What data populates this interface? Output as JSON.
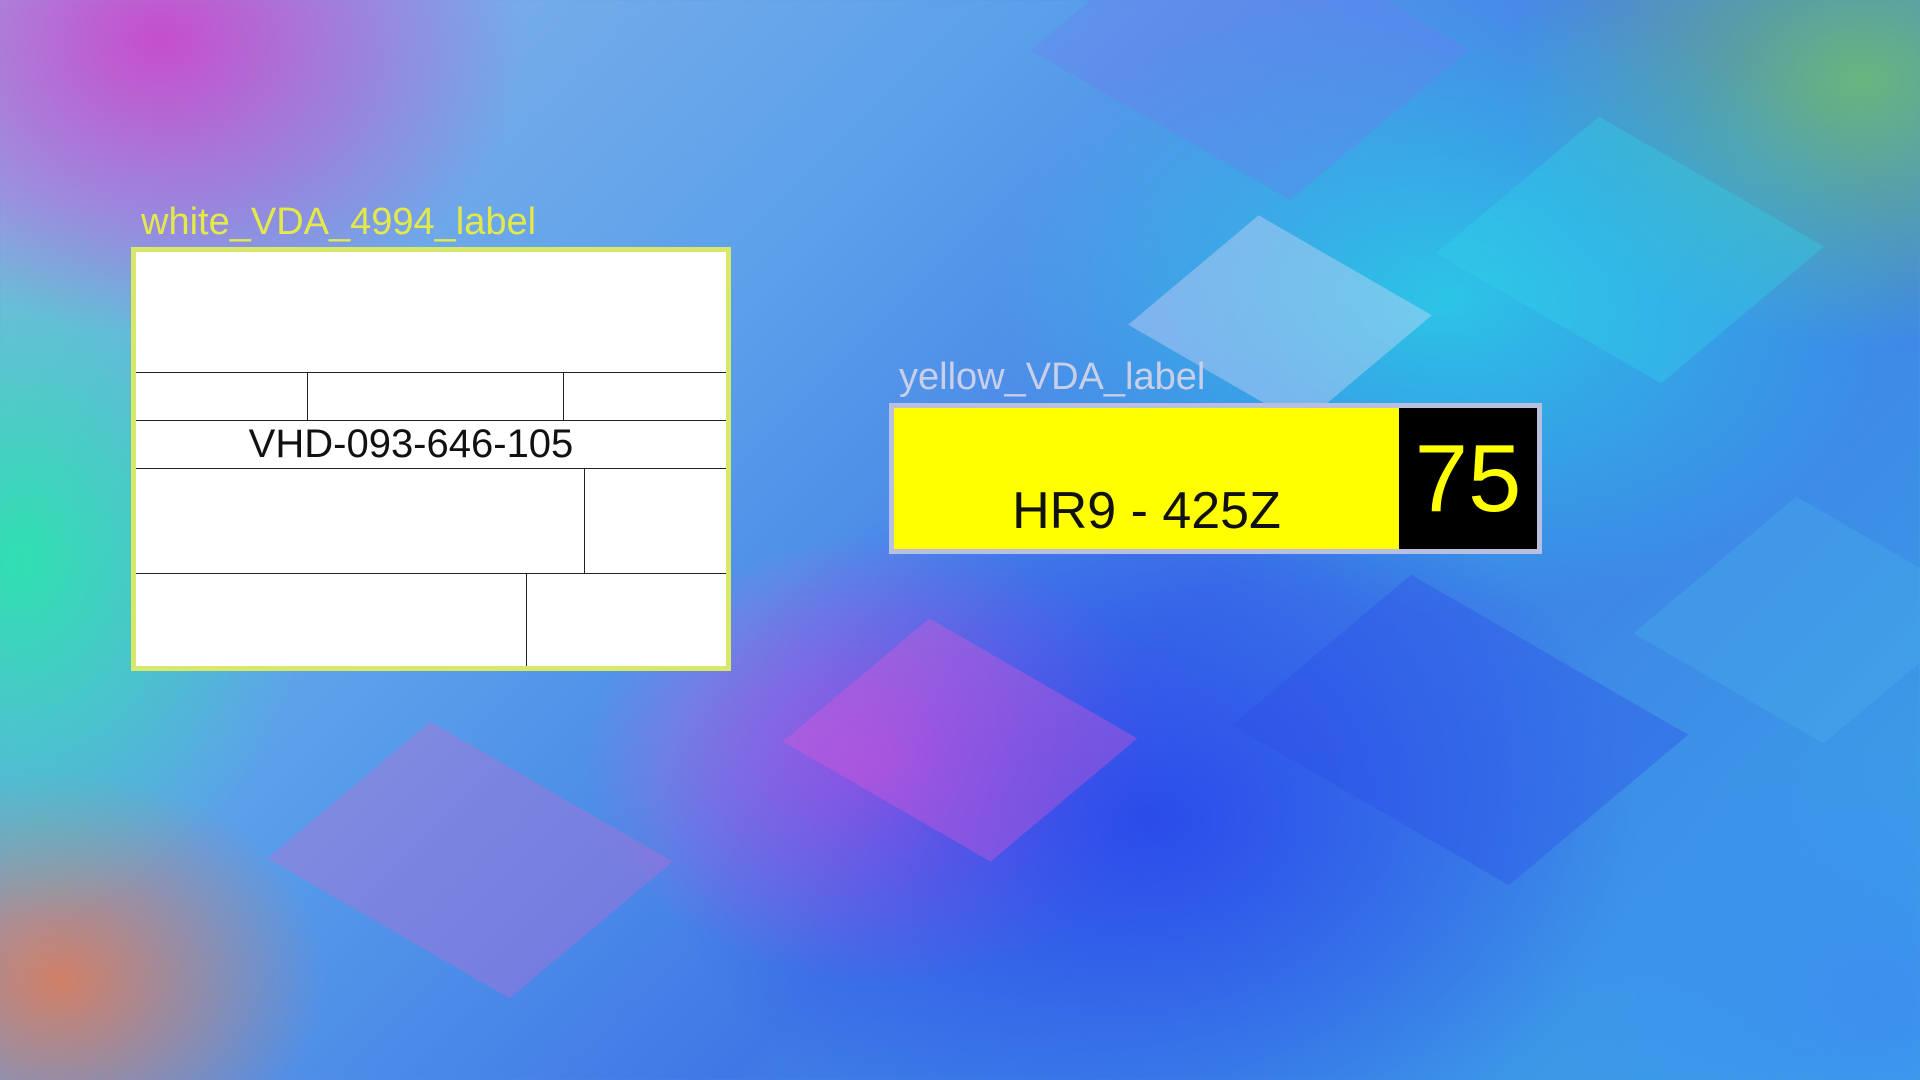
{
  "white_label": {
    "caption": "white_VDA_4994_label",
    "code": "VHD-093-646-105",
    "border_color": "#d8e86a"
  },
  "yellow_label": {
    "caption": "yellow_VDA_label",
    "plate": "HR9 - 425Z",
    "number": "75",
    "background_color": "#ffff00",
    "number_box_color": "#000000"
  }
}
